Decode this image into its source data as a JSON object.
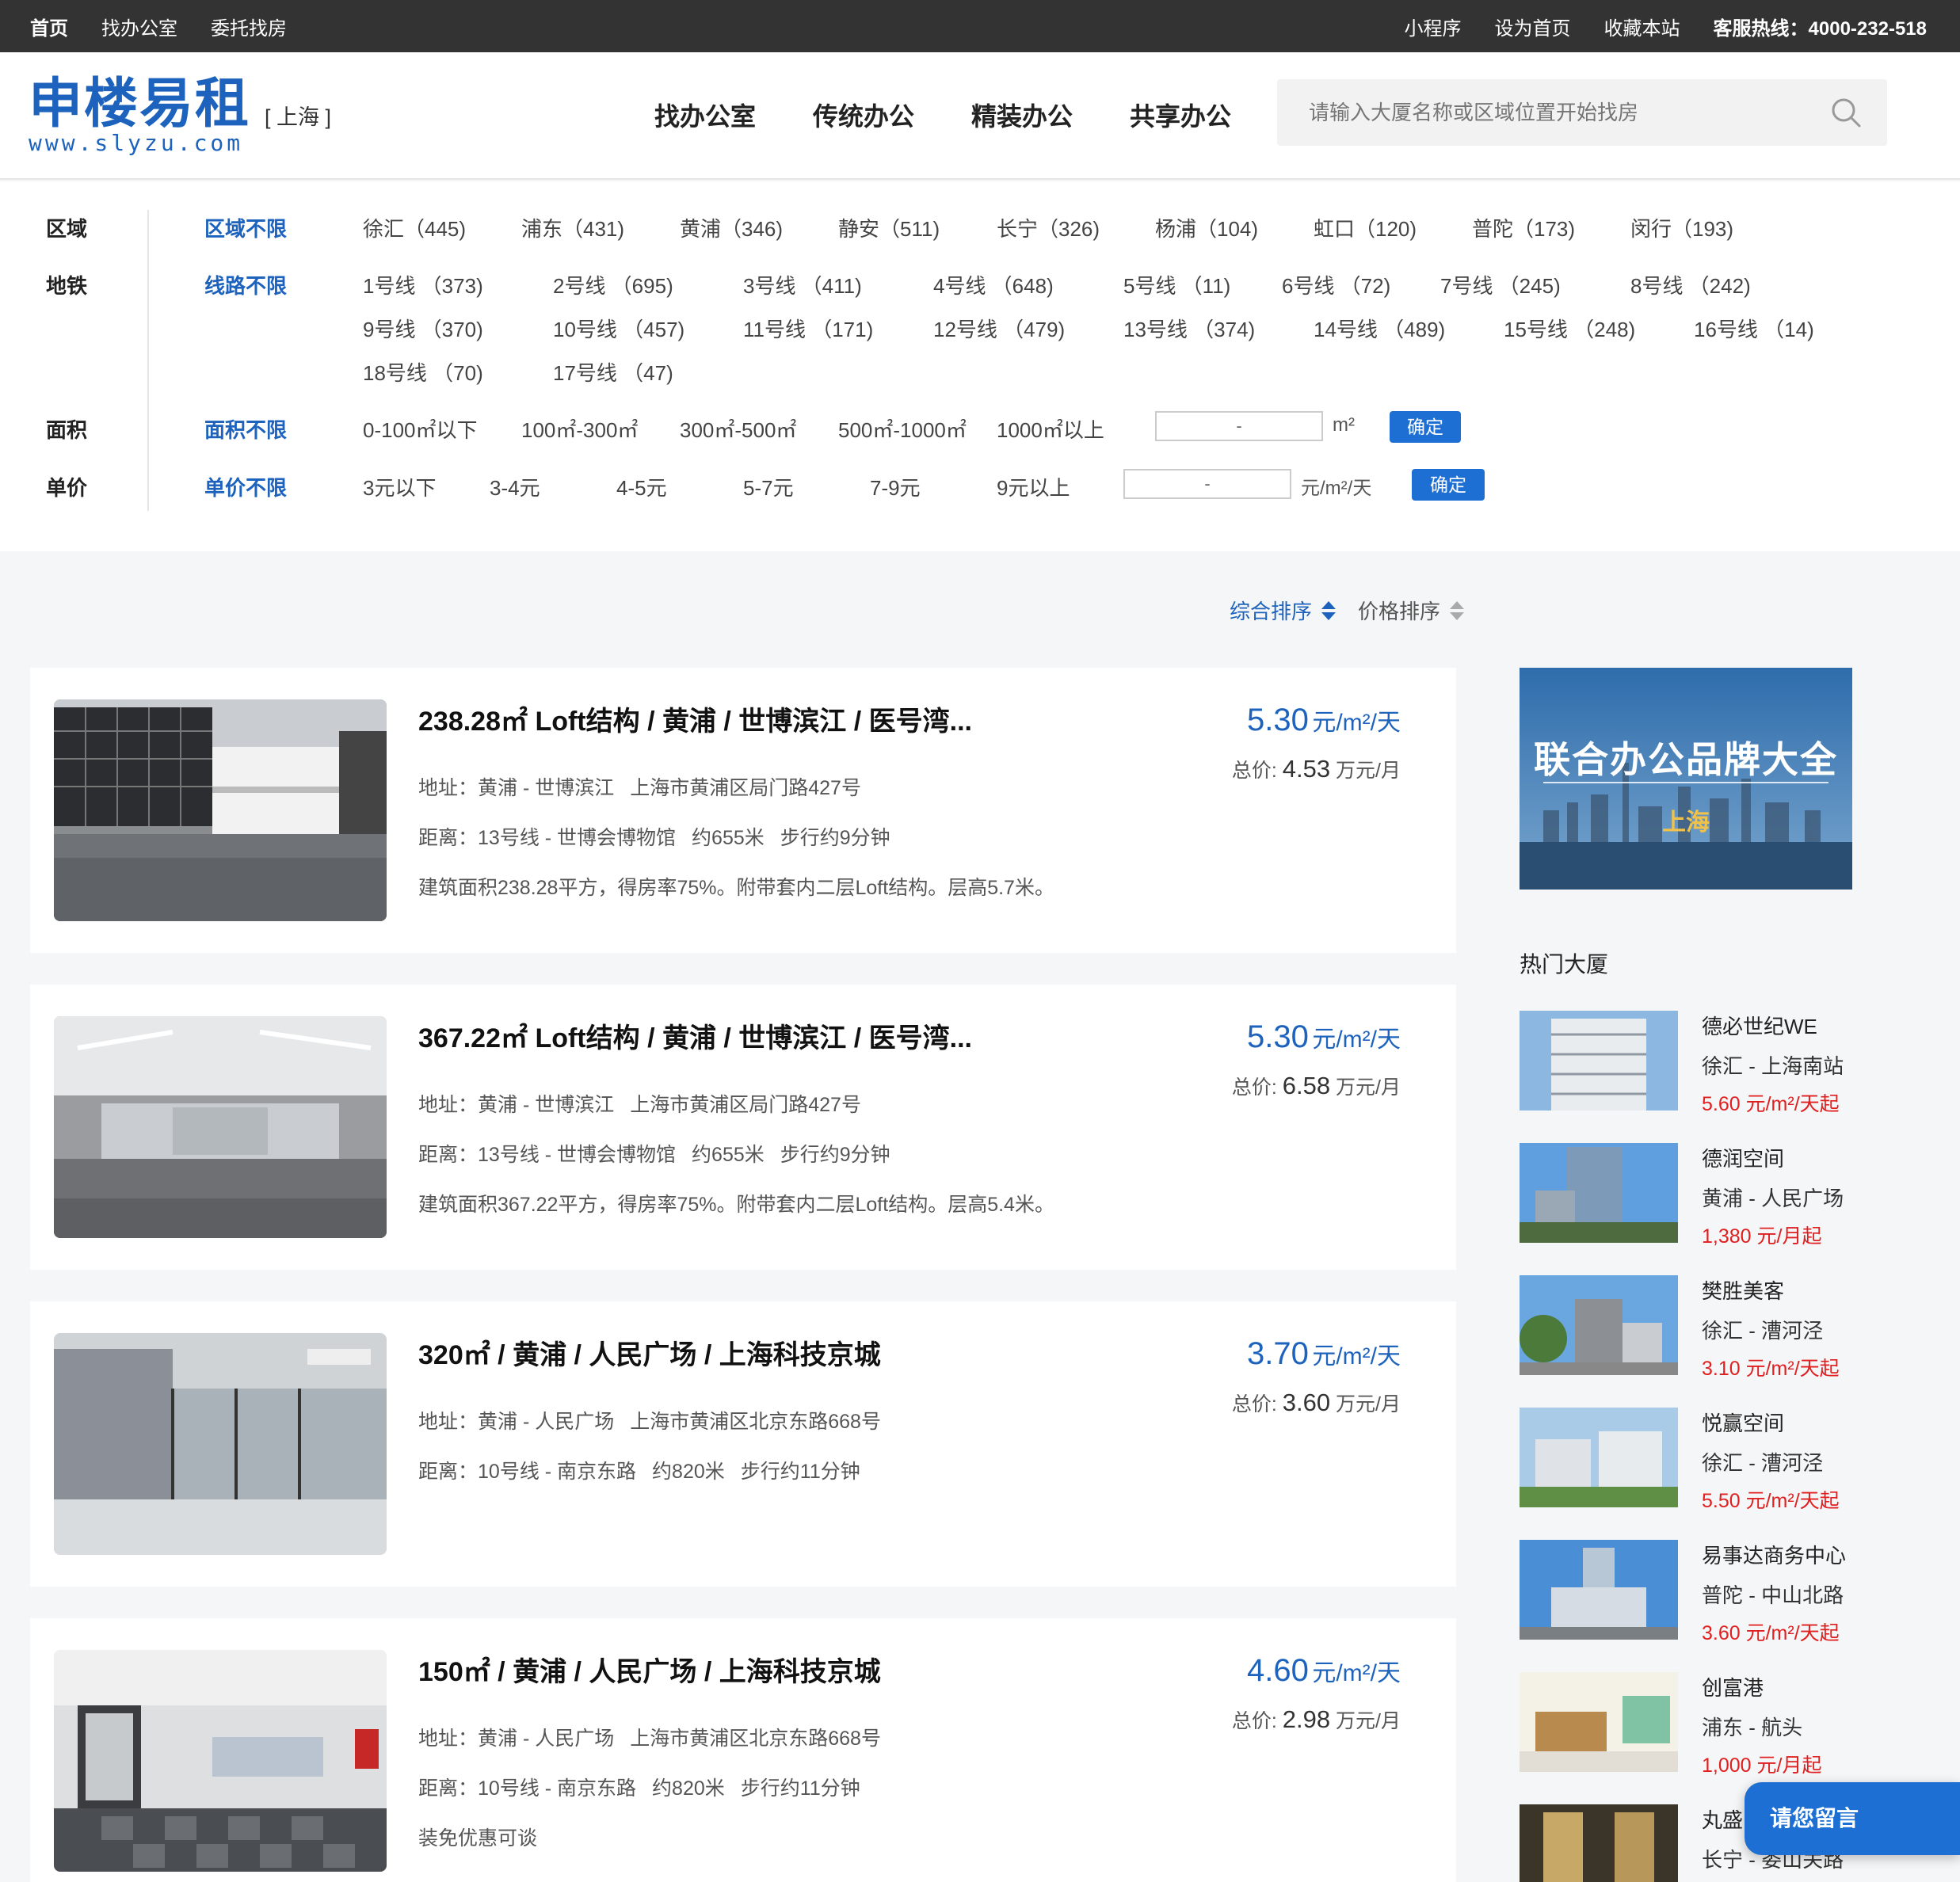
{
  "topbar": {
    "left": [
      "首页",
      "找办公室",
      "委托找房"
    ],
    "right": [
      "小程序",
      "设为首页",
      "收藏本站"
    ],
    "hotline": "客服热线：4000-232-518"
  },
  "header": {
    "logo_cn": "申楼易租",
    "logo_en": "www.slyzu.com",
    "city": "[ 上海 ]",
    "nav": [
      "找办公室",
      "传统办公",
      "精装办公",
      "共享办公"
    ],
    "search_placeholder": "请输入大厦名称或区域位置开始找房"
  },
  "filters": {
    "area": {
      "label": "区域",
      "all": "区域不限",
      "options": [
        "徐汇（445)",
        "浦东（431)",
        "黄浦（346)",
        "静安（511)",
        "长宁（326)",
        "杨浦（104)",
        "虹口（120)",
        "普陀（173)",
        "闵行（193)"
      ]
    },
    "metro": {
      "label": "地铁",
      "all": "线路不限",
      "row1": [
        "1号线 （373)",
        "2号线 （695)",
        "3号线 （411)",
        "4号线 （648)",
        "5号线 （11)",
        "6号线 （72)",
        "7号线 （245)",
        "8号线 （242)"
      ],
      "row2": [
        "9号线 （370)",
        "10号线 （457)",
        "11号线 （171)",
        "12号线 （479)",
        "13号线 （374)",
        "14号线 （489)",
        "15号线 （248)",
        "16号线 （14)"
      ],
      "row3": [
        "18号线 （70)",
        "17号线 （47)"
      ]
    },
    "size": {
      "label": "面积",
      "all": "面积不限",
      "options": [
        "0-100㎡以下",
        "100㎡-300㎡",
        "300㎡-500㎡",
        "500㎡-1000㎡",
        "1000㎡以上"
      ],
      "range_sep": "-",
      "unit": "m²",
      "confirm": "确定"
    },
    "price": {
      "label": "单价",
      "all": "单价不限",
      "options": [
        "3元以下",
        "3-4元",
        "4-5元",
        "5-7元",
        "7-9元",
        "9元以上"
      ],
      "range_sep": "-",
      "unit": "元/m²/天",
      "confirm": "确定"
    }
  },
  "sort": {
    "default": "综合排序",
    "price": "价格排序"
  },
  "listings": [
    {
      "title": "238.28㎡ Loft结构 / 黄浦 / 世博滨江 / 医号湾...",
      "addr_label": "地址：",
      "addr_area": "黄浦 - 世博滨江",
      "addr_street": "上海市黄浦区局门路427号",
      "dist_label": "距离：",
      "dist_station": "13号线 - 世博会博物馆",
      "dist_m": "约655米",
      "dist_walk": "步行约9分钟",
      "desc": "建筑面积238.28平方，得房率75%。附带套内二层Loft结构。层高5.7米。",
      "price": "5.30",
      "price_unit": "元/m²/天",
      "total_label": "总价:",
      "total": "4.53",
      "total_unit": "万元/月"
    },
    {
      "title": "367.22㎡ Loft结构 / 黄浦 / 世博滨江 / 医号湾...",
      "addr_label": "地址：",
      "addr_area": "黄浦 - 世博滨江",
      "addr_street": "上海市黄浦区局门路427号",
      "dist_label": "距离：",
      "dist_station": "13号线 - 世博会博物馆",
      "dist_m": "约655米",
      "dist_walk": "步行约9分钟",
      "desc": "建筑面积367.22平方，得房率75%。附带套内二层Loft结构。层高5.4米。",
      "price": "5.30",
      "price_unit": "元/m²/天",
      "total_label": "总价:",
      "total": "6.58",
      "total_unit": "万元/月"
    },
    {
      "title": "320㎡ / 黄浦 / 人民广场 / 上海科技京城",
      "addr_label": "地址：",
      "addr_area": "黄浦 - 人民广场",
      "addr_street": "上海市黄浦区北京东路668号",
      "dist_label": "距离：",
      "dist_station": "10号线 - 南京东路",
      "dist_m": "约820米",
      "dist_walk": "步行约11分钟",
      "desc": "",
      "price": "3.70",
      "price_unit": "元/m²/天",
      "total_label": "总价:",
      "total": "3.60",
      "total_unit": "万元/月"
    },
    {
      "title": "150㎡ / 黄浦 / 人民广场 / 上海科技京城",
      "addr_label": "地址：",
      "addr_area": "黄浦 - 人民广场",
      "addr_street": "上海市黄浦区北京东路668号",
      "dist_label": "距离：",
      "dist_station": "10号线 - 南京东路",
      "dist_m": "约820米",
      "dist_walk": "步行约11分钟",
      "desc": "装免优惠可谈",
      "price": "4.60",
      "price_unit": "元/m²/天",
      "total_label": "总价:",
      "total": "2.98",
      "total_unit": "万元/月"
    }
  ],
  "sidebar": {
    "banner_title": "联合办公品牌大全",
    "banner_city": "上海",
    "hot_title": "热门大厦",
    "hot": [
      {
        "name": "德必世纪WE",
        "area": "徐汇 - 上海南站",
        "price": "5.60 元/m²/天起"
      },
      {
        "name": "德润空间",
        "area": "黄浦 - 人民广场",
        "price": "1,380 元/月起"
      },
      {
        "name": "樊胜美客",
        "area": "徐汇 - 漕河泾",
        "price": "3.10 元/m²/天起"
      },
      {
        "name": "悦赢空间",
        "area": "徐汇 - 漕河泾",
        "price": "5.50 元/m²/天起"
      },
      {
        "name": "易事达商务中心",
        "area": "普陀 - 中山北路",
        "price": "3.60 元/m²/天起"
      },
      {
        "name": "创富港",
        "area": "浦东 - 航头",
        "price": "1,000 元/月起"
      },
      {
        "name": "丸盛",
        "area": "长宁 - 娄山关路",
        "price": ""
      }
    ]
  },
  "message_button": "请您留言",
  "colors": {
    "brand": "#1d63bd",
    "button": "#1d6fd3",
    "hot_price": "#e02020",
    "topbar": "#333333"
  }
}
